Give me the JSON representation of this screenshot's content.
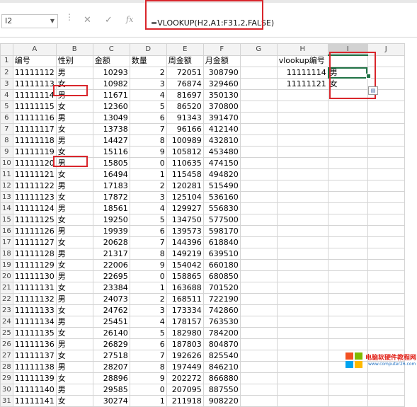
{
  "formula_bar": {
    "name_box": "I2",
    "cancel_icon": "✕",
    "enter_icon": "✓",
    "fx_label": "fx",
    "formula": "=VLOOKUP(H2,A1:F31,2,FALSE)"
  },
  "columns": [
    "A",
    "B",
    "C",
    "D",
    "E",
    "F",
    "G",
    "H",
    "I",
    "J"
  ],
  "rows": [
    {
      "n": "1",
      "a": "编号",
      "b": "性别",
      "c": "金额",
      "d": "数量",
      "e": "周金额",
      "f": "月金额",
      "h": "vlookup编号",
      "i": ""
    },
    {
      "n": "2",
      "a": "11111112",
      "b": "男",
      "c": "10293",
      "d": "2",
      "e": "72051",
      "f": "308790",
      "h": "11111114",
      "i": "男"
    },
    {
      "n": "3",
      "a": "11111113",
      "b": "女",
      "c": "10982",
      "d": "3",
      "e": "76874",
      "f": "329460",
      "h": "11111121",
      "i": "女"
    },
    {
      "n": "4",
      "a": "11111114",
      "b": "男",
      "c": "11671",
      "d": "4",
      "e": "81697",
      "f": "350130",
      "h": "",
      "i": ""
    },
    {
      "n": "5",
      "a": "11111115",
      "b": "女",
      "c": "12360",
      "d": "5",
      "e": "86520",
      "f": "370800",
      "h": "",
      "i": ""
    },
    {
      "n": "6",
      "a": "11111116",
      "b": "男",
      "c": "13049",
      "d": "6",
      "e": "91343",
      "f": "391470",
      "h": "",
      "i": ""
    },
    {
      "n": "7",
      "a": "11111117",
      "b": "女",
      "c": "13738",
      "d": "7",
      "e": "96166",
      "f": "412140",
      "h": "",
      "i": ""
    },
    {
      "n": "8",
      "a": "11111118",
      "b": "男",
      "c": "14427",
      "d": "8",
      "e": "100989",
      "f": "432810",
      "h": "",
      "i": ""
    },
    {
      "n": "9",
      "a": "11111119",
      "b": "女",
      "c": "15116",
      "d": "9",
      "e": "105812",
      "f": "453480",
      "h": "",
      "i": ""
    },
    {
      "n": "10",
      "a": "11111120",
      "b": "男",
      "c": "15805",
      "d": "0",
      "e": "110635",
      "f": "474150",
      "h": "",
      "i": ""
    },
    {
      "n": "11",
      "a": "11111121",
      "b": "女",
      "c": "16494",
      "d": "1",
      "e": "115458",
      "f": "494820",
      "h": "",
      "i": ""
    },
    {
      "n": "12",
      "a": "11111122",
      "b": "男",
      "c": "17183",
      "d": "2",
      "e": "120281",
      "f": "515490",
      "h": "",
      "i": ""
    },
    {
      "n": "13",
      "a": "11111123",
      "b": "女",
      "c": "17872",
      "d": "3",
      "e": "125104",
      "f": "536160",
      "h": "",
      "i": ""
    },
    {
      "n": "14",
      "a": "11111124",
      "b": "男",
      "c": "18561",
      "d": "4",
      "e": "129927",
      "f": "556830",
      "h": "",
      "i": ""
    },
    {
      "n": "15",
      "a": "11111125",
      "b": "女",
      "c": "19250",
      "d": "5",
      "e": "134750",
      "f": "577500",
      "h": "",
      "i": ""
    },
    {
      "n": "16",
      "a": "11111126",
      "b": "男",
      "c": "19939",
      "d": "6",
      "e": "139573",
      "f": "598170",
      "h": "",
      "i": ""
    },
    {
      "n": "17",
      "a": "11111127",
      "b": "女",
      "c": "20628",
      "d": "7",
      "e": "144396",
      "f": "618840",
      "h": "",
      "i": ""
    },
    {
      "n": "18",
      "a": "11111128",
      "b": "男",
      "c": "21317",
      "d": "8",
      "e": "149219",
      "f": "639510",
      "h": "",
      "i": ""
    },
    {
      "n": "19",
      "a": "11111129",
      "b": "女",
      "c": "22006",
      "d": "9",
      "e": "154042",
      "f": "660180",
      "h": "",
      "i": ""
    },
    {
      "n": "20",
      "a": "11111130",
      "b": "男",
      "c": "22695",
      "d": "0",
      "e": "158865",
      "f": "680850",
      "h": "",
      "i": ""
    },
    {
      "n": "21",
      "a": "11111131",
      "b": "女",
      "c": "23384",
      "d": "1",
      "e": "163688",
      "f": "701520",
      "h": "",
      "i": ""
    },
    {
      "n": "22",
      "a": "11111132",
      "b": "男",
      "c": "24073",
      "d": "2",
      "e": "168511",
      "f": "722190",
      "h": "",
      "i": ""
    },
    {
      "n": "23",
      "a": "11111133",
      "b": "女",
      "c": "24762",
      "d": "3",
      "e": "173334",
      "f": "742860",
      "h": "",
      "i": ""
    },
    {
      "n": "24",
      "a": "11111134",
      "b": "男",
      "c": "25451",
      "d": "4",
      "e": "178157",
      "f": "763530",
      "h": "",
      "i": ""
    },
    {
      "n": "25",
      "a": "11111135",
      "b": "女",
      "c": "26140",
      "d": "5",
      "e": "182980",
      "f": "784200",
      "h": "",
      "i": ""
    },
    {
      "n": "26",
      "a": "11111136",
      "b": "男",
      "c": "26829",
      "d": "6",
      "e": "187803",
      "f": "804870",
      "h": "",
      "i": ""
    },
    {
      "n": "27",
      "a": "11111137",
      "b": "女",
      "c": "27518",
      "d": "7",
      "e": "192626",
      "f": "825540",
      "h": "",
      "i": ""
    },
    {
      "n": "28",
      "a": "11111138",
      "b": "男",
      "c": "28207",
      "d": "8",
      "e": "197449",
      "f": "846210",
      "h": "",
      "i": ""
    },
    {
      "n": "29",
      "a": "11111139",
      "b": "女",
      "c": "28896",
      "d": "9",
      "e": "202272",
      "f": "866880",
      "h": "",
      "i": ""
    },
    {
      "n": "30",
      "a": "11111140",
      "b": "男",
      "c": "29585",
      "d": "0",
      "e": "207095",
      "f": "887550",
      "h": "",
      "i": ""
    },
    {
      "n": "31",
      "a": "11111141",
      "b": "女",
      "c": "30274",
      "d": "1",
      "e": "211918",
      "f": "908220",
      "h": "",
      "i": ""
    }
  ],
  "watermark": {
    "title": "电脑软硬件教程网",
    "url": "www.computer26.com"
  },
  "colors": {
    "highlight_border": "#d9262c",
    "selection": "#217346"
  }
}
